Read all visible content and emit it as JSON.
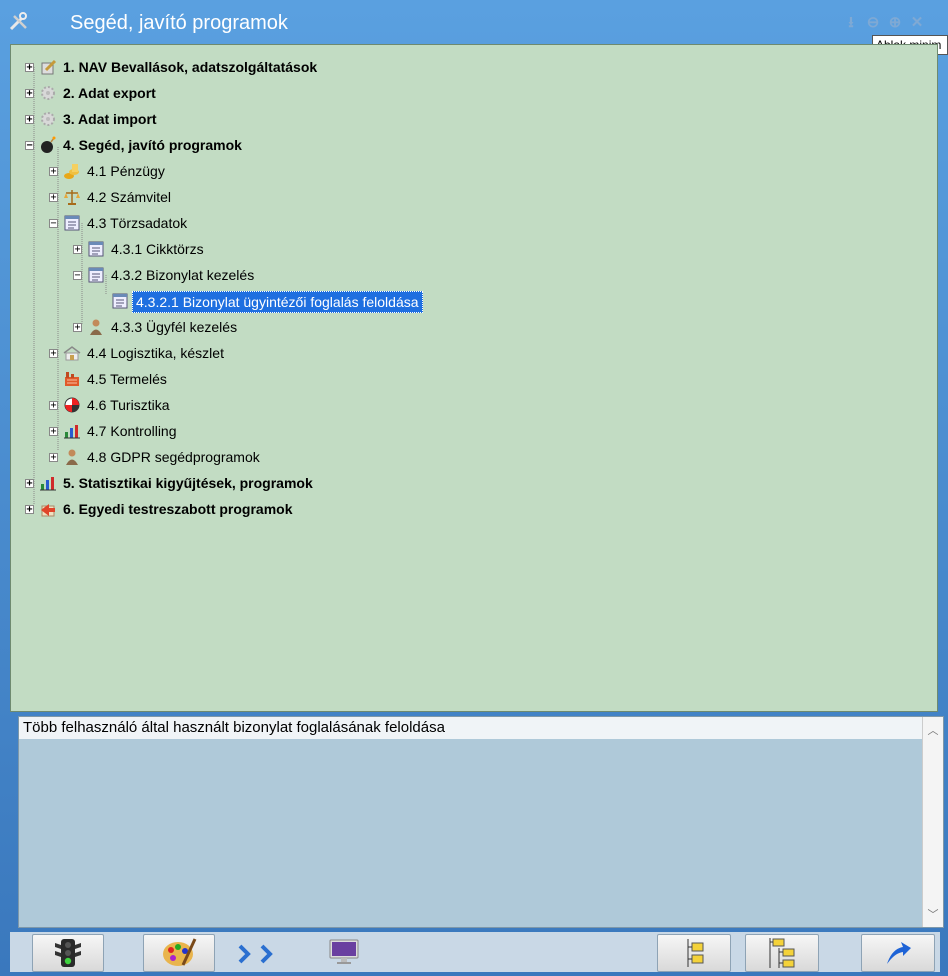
{
  "window": {
    "title": "Segéd, javító programok",
    "tooltip": "Ablak minim"
  },
  "tree": [
    {
      "label": "1. NAV Bevallások, adatszolgáltatások",
      "icon": "documents-icon",
      "bold": true
    },
    {
      "label": "2. Adat export",
      "icon": "gear-icon",
      "bold": true
    },
    {
      "label": "3. Adat import",
      "icon": "gear-icon",
      "bold": true
    },
    {
      "label": "4. Segéd, javító programok",
      "icon": "bomb-icon",
      "bold": true
    },
    {
      "label": "4.1 Pénzügy",
      "icon": "coins-icon"
    },
    {
      "label": "4.2 Számvitel",
      "icon": "scales-icon"
    },
    {
      "label": "4.3 Törzsadatok",
      "icon": "form-icon"
    },
    {
      "label": "4.3.1 Cikktörzs",
      "icon": "form-icon"
    },
    {
      "label": "4.3.2 Bizonylat kezelés",
      "icon": "form-icon"
    },
    {
      "label": "4.3.2.1 Bizonylat ügyintézői foglalás feloldása",
      "icon": "form-icon",
      "selected": true
    },
    {
      "label": "4.3.3 Ügyfél kezelés",
      "icon": "person-icon"
    },
    {
      "label": "4.4 Logisztika, készlet",
      "icon": "warehouse-icon"
    },
    {
      "label": "4.5 Termelés",
      "icon": "factory-icon"
    },
    {
      "label": "4.6 Turisztika",
      "icon": "beachball-icon"
    },
    {
      "label": "4.7 Kontrolling",
      "icon": "bar-chart-icon"
    },
    {
      "label": "4.8 GDPR segédprogramok",
      "icon": "person-icon"
    },
    {
      "label": "5. Statisztikai kigyűjtések, programok",
      "icon": "bar-chart-icon",
      "bold": true
    },
    {
      "label": "6. Egyedi testreszabott programok",
      "icon": "custom-arrow-icon",
      "bold": true
    }
  ],
  "description": "Több felhasználó által használt bizonylat foglalásának feloldása",
  "toolbar": {
    "buttons": [
      "traffic-light-icon",
      "palette-icon",
      "forward-arrows-icon",
      "monitor-icon",
      "collapse-tree-icon",
      "expand-tree-icon",
      "exit-arrow-icon"
    ]
  },
  "colors": {
    "tree_background": "#c2dcc3",
    "description_background": "#afc9d9",
    "selection": "#1e6fe0",
    "title_bar": "#4a8fd5"
  }
}
